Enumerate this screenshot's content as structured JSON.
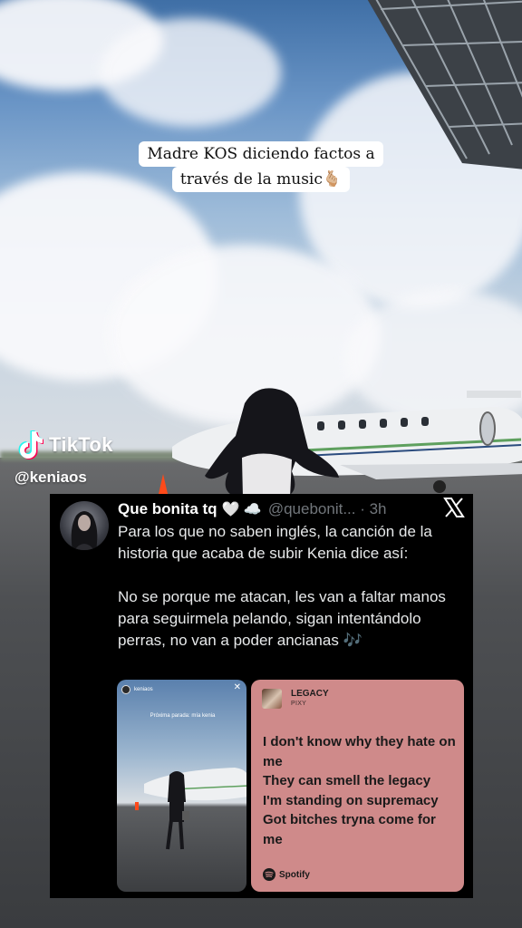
{
  "caption": {
    "line1": "Madre KOS diciendo factos a",
    "line2": "través de la music🫰🏼"
  },
  "watermark": {
    "brand": "TikTok",
    "handle": "@keniaos"
  },
  "tweet": {
    "display_name": "Que bonita tq",
    "name_emojis": "🤍 ☁️",
    "handle_time": "@quebonit... · 3h",
    "paragraph1": "Para los que no saben inglés, la canción de la historia que acaba de subir Kenia dice así:",
    "paragraph2": "No se porque me atacan, les van a faltar manos para seguirmela pelando, sigan intentándolo perras, no van a poder ancianas 🎶",
    "media": {
      "story_user": "keniaos",
      "story_caption": "Próxima parada: mía kenia",
      "song_title": "LEGACY",
      "song_artist": "PIXY",
      "lyric_lines": [
        "I don't know why they hate on me",
        "They can smell the legacy",
        "I'm standing on supremacy",
        "Got bitches tryna come for me"
      ],
      "source": "Spotify"
    }
  },
  "icons": {
    "close": "x-logo-icon",
    "tiktok": "tiktok-note-icon",
    "spotify": "spotify-icon"
  },
  "colors": {
    "tweet_bg": "#000000",
    "lyric_card": "#cf8a8a",
    "muted": "#71767b"
  }
}
